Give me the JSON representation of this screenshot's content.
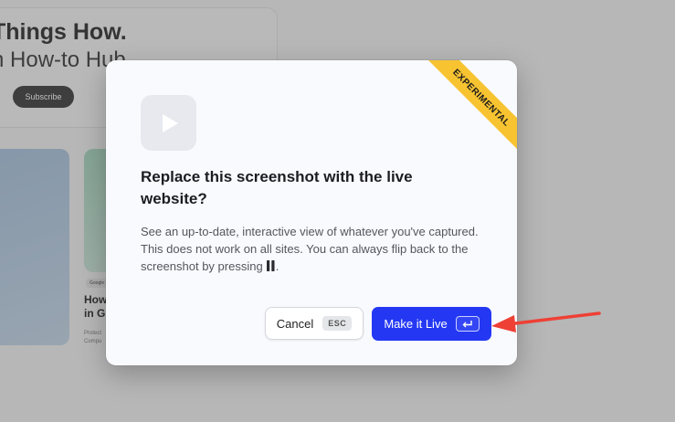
{
  "background_page": {
    "title": "Things How.",
    "subtitle": "h How-to Hub.",
    "subscribe_label": "Subscribe",
    "card_tag": "Google",
    "card_headline": "How\nin G",
    "card_snippet": "Protect\nCompu"
  },
  "modal": {
    "ribbon_label": "EXPERIMENTAL",
    "play_icon": "play-icon",
    "title": "Replace this screenshot with the live website?",
    "body": "See an up-to-date, interactive view of whatever you've captured. This does not work on all sites. You can always flip back to the screenshot by pressing",
    "body_end": ".",
    "cancel_label": "Cancel",
    "cancel_shortcut": "ESC",
    "make_live_label": "Make it Live",
    "make_live_shortcut_icon": "enter-key-icon"
  },
  "colors": {
    "primary_button": "#2438f4",
    "ribbon": "#f7c331",
    "annotation_arrow": "#ee4035"
  }
}
